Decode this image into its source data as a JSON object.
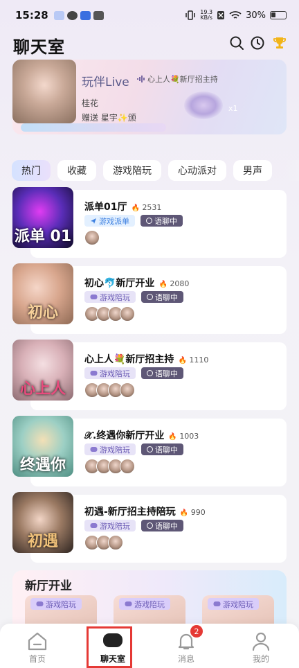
{
  "status_bar": {
    "time": "15:28",
    "net_speed_value": "19.3",
    "net_speed_unit": "KB/s",
    "battery": "30%"
  },
  "header": {
    "title": "聊天室",
    "icons": [
      "search-icon",
      "history-clock-icon",
      "trophy-icon"
    ]
  },
  "banner": {
    "brand": "玩伴Live",
    "room_name": "心上人💐新厅招主持",
    "host": "桂花",
    "gift_text": "赠送 星宇✨颁",
    "gift_count": "x1"
  },
  "tabs": [
    {
      "label": "热门",
      "active": true
    },
    {
      "label": "收藏",
      "active": false
    },
    {
      "label": "游戏陪玩",
      "active": false
    },
    {
      "label": "心动派对",
      "active": false
    },
    {
      "label": "男声",
      "active": false
    }
  ],
  "rooms": [
    {
      "name": "派单01厅",
      "heat": "2531",
      "type": "游戏派单",
      "status": "语聊中",
      "cover_text": "派单 01",
      "avatars": 1
    },
    {
      "name": "初心🐬新厅开业",
      "heat": "2080",
      "type": "游戏陪玩",
      "status": "语聊中",
      "cover_text": "初心",
      "avatars": 4
    },
    {
      "name": "心上人💐新厅招主持",
      "heat": "1110",
      "type": "游戏陪玩",
      "status": "语聊中",
      "cover_text": "心上人",
      "avatars": 4
    },
    {
      "name": "𝒳.终遇你新厅开业",
      "heat": "1003",
      "type": "游戏陪玩",
      "status": "语聊中",
      "cover_text": "终遇你",
      "avatars": 4
    },
    {
      "name": "初遇-新厅招主持陪玩",
      "heat": "990",
      "type": "游戏陪玩",
      "status": "语聊中",
      "cover_text": "初遇",
      "avatars": 3
    }
  ],
  "new_section": {
    "title": "新厅开业",
    "cards": [
      {
        "type": "游戏陪玩"
      },
      {
        "type": "游戏陪玩"
      },
      {
        "type": "游戏陪玩"
      }
    ]
  },
  "bottom_nav": [
    {
      "label": "首页",
      "icon": "home-icon",
      "active": false
    },
    {
      "label": "聊天室",
      "icon": "chat-bubble-icon",
      "active": true
    },
    {
      "label": "消息",
      "icon": "bell-icon",
      "active": false,
      "badge": "2"
    },
    {
      "label": "我的",
      "icon": "profile-icon",
      "active": false
    }
  ],
  "colors": {
    "accent": "#6b5bb5",
    "voice_badge": "#5e5776",
    "flame": "#ee4b3c",
    "nav_highlight": "#e53935"
  }
}
